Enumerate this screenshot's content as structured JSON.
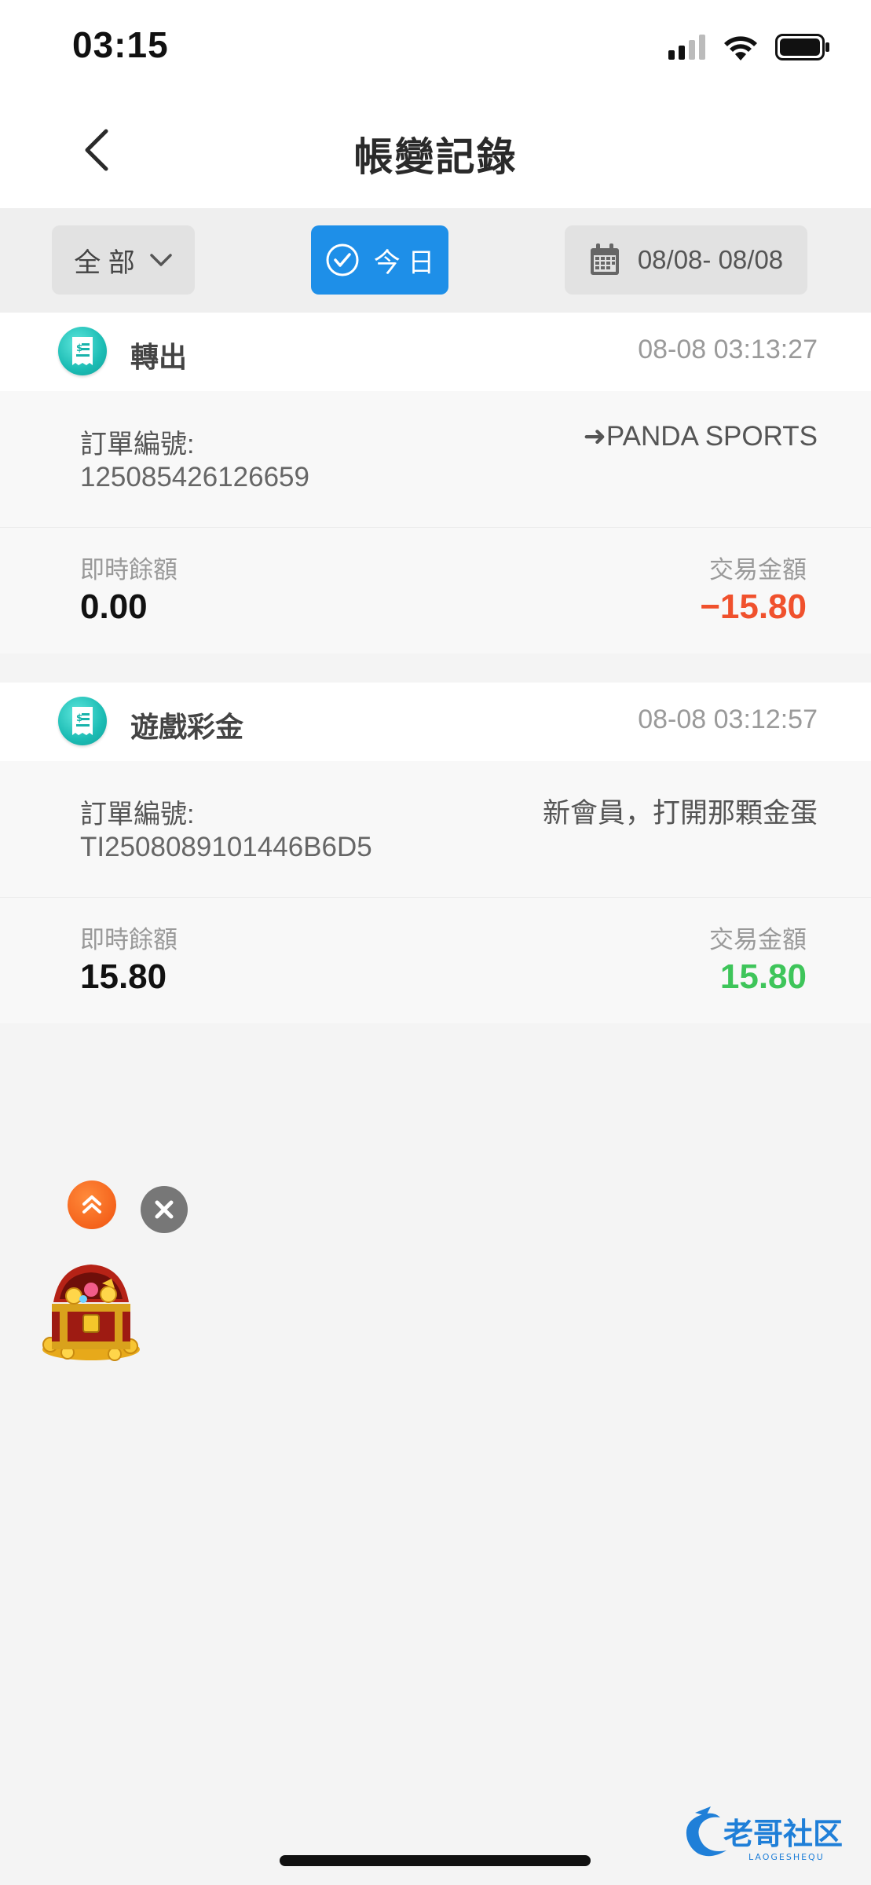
{
  "status_bar": {
    "time": "03:15"
  },
  "header": {
    "title": "帳變記錄"
  },
  "filters": {
    "all_label": "全 部",
    "today_label": "今 日",
    "date_range": "08/08- 08/08"
  },
  "records": [
    {
      "type": "轉出",
      "time": "08-08 03:13:27",
      "order_label": "訂單編號:",
      "order_number": "125085426126659",
      "description": "➜PANDA SPORTS",
      "balance_label": "即時餘額",
      "balance": "0.00",
      "amount_label": "交易金額",
      "amount": "−15.80",
      "amount_color": "#f0512d"
    },
    {
      "type": "遊戲彩金",
      "time": "08-08 03:12:57",
      "order_label": "訂單編號:",
      "order_number": "TI2508089101446B6D5",
      "description": "新會員，打開那顆金蛋",
      "balance_label": "即時餘額",
      "balance": "15.80",
      "amount_label": "交易金額",
      "amount": "15.80",
      "amount_color": "#3ec55a"
    }
  ],
  "watermark": {
    "text": "老哥社区",
    "subtext": "LAOGESHEQU"
  },
  "icons": {
    "back": "chevron-left-icon",
    "filter_dropdown": "chevron-down-icon",
    "today_check": "check-circle-icon",
    "calendar": "calendar-icon",
    "record": "receipt-icon",
    "float_up": "double-chevron-up-icon",
    "float_close": "close-icon",
    "treasure": "treasure-chest-icon"
  }
}
